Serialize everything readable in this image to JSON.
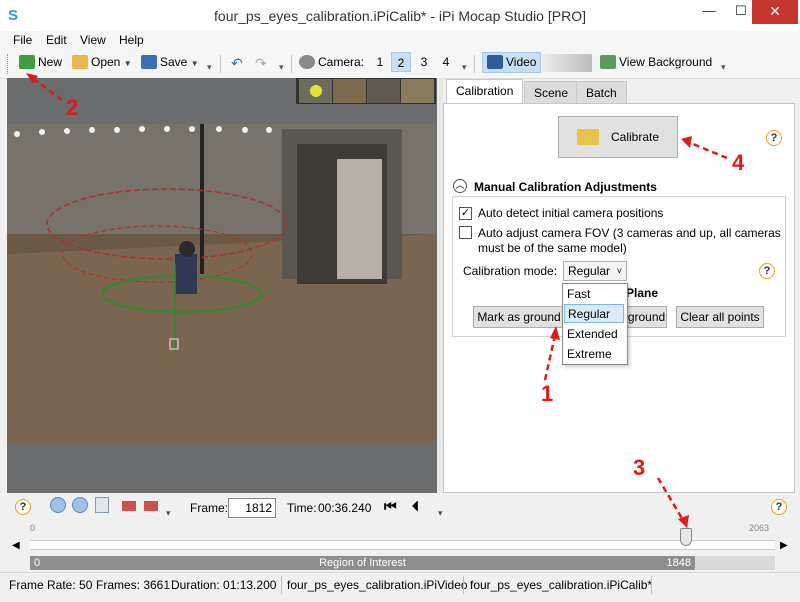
{
  "window": {
    "title": "four_ps_eyes_calibration.iPiCalib* - iPi Mocap Studio [PRO]",
    "app_icon_glyph": "S",
    "minimize": "—",
    "maximize": "☐",
    "close": "✕"
  },
  "menu": [
    "File",
    "Edit",
    "View",
    "Help"
  ],
  "toolbar": {
    "new_label": "New",
    "open_label": "Open",
    "save_label": "Save",
    "camera_label": "Camera:",
    "cameras": [
      "1",
      "2",
      "3",
      "4"
    ],
    "selected_camera": "2",
    "video_label": "Video",
    "view_background_label": "View Background"
  },
  "tabs": [
    "Calibration",
    "Scene",
    "Batch"
  ],
  "active_tab": "Calibration",
  "calibration": {
    "calibrate_label": "Calibrate",
    "section_title": "Manual Calibration Adjustments",
    "auto_detect_label": "Auto detect initial camera positions",
    "auto_detect_checked": true,
    "auto_fov_line1": "Auto adjust camera FOV (3 cameras and up, all cameras",
    "auto_fov_line2": "must be of the same model)",
    "auto_fov_checked": false,
    "mode_label": "Calibration mode:",
    "mode_value": "Regular",
    "mode_options": [
      "Fast",
      "Regular",
      "Extended",
      "Extreme"
    ],
    "ground_plane_partial": "Plane",
    "mark_as_ground_label": "Mark as ground",
    "ground_partial_label": "ground",
    "clear_all_points_label": "Clear all points",
    "help_glyph": "?"
  },
  "playback": {
    "frame_label": "Frame:",
    "frame_value": "1812",
    "time_label": "Time:",
    "time_value": "00:36.240"
  },
  "timeline": {
    "start": "0",
    "end": "2063",
    "roi_start": "0",
    "roi_label": "Region of Interest",
    "roi_end": "1848"
  },
  "status": {
    "frame_rate": "Frame Rate: 50",
    "frames": "Frames: 3661",
    "duration": "Duration: 01:13.200",
    "video_file": "four_ps_eyes_calibration.iPiVideo",
    "calib_file": "four_ps_eyes_calibration.iPiCalib*"
  },
  "annotations": [
    "1",
    "2",
    "3",
    "4"
  ],
  "colors": {
    "annotation": "#e01a1a",
    "help_ring": "#e8a21a",
    "selection": "#c7dff4"
  }
}
